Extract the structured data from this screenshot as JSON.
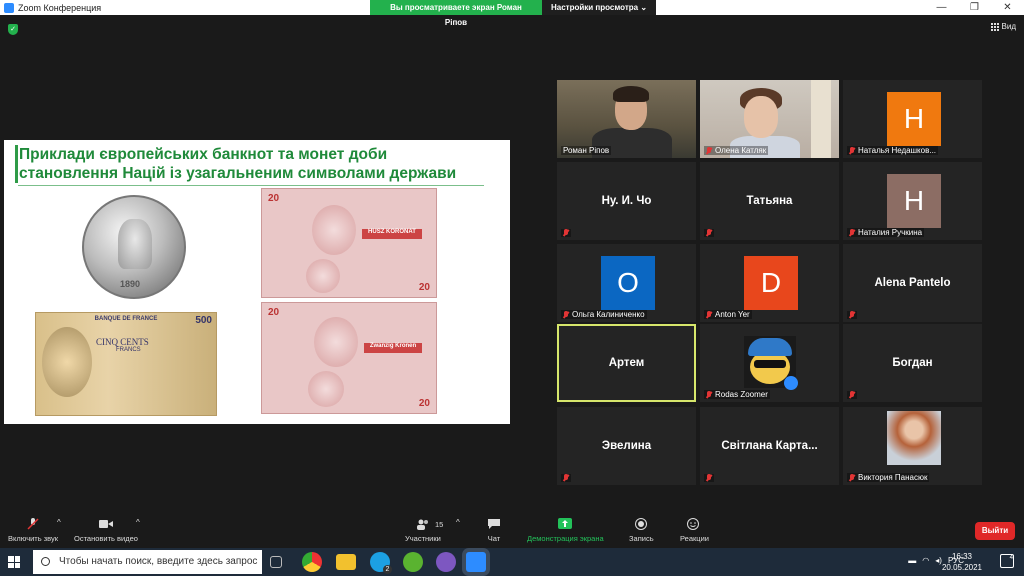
{
  "window": {
    "title": "Zoom Конференция"
  },
  "share": {
    "viewing": "Вы просматриваете экран Роман Ріпов",
    "view_options": "Настройки просмотра ⌄"
  },
  "view_button": "Вид",
  "slide": {
    "line1": "Приклади європейських банкнот та монет доби",
    "line2": "становлення Націй із узагальненим символами держави",
    "coin_year": "1890",
    "note_value": "20",
    "note_top_label": "HUSZ KORONAT",
    "note_bottom_label": "Zwanzig Kronen",
    "fr_header": "BANQUE DE FRANCE",
    "fr_value": "500",
    "fr_text": "CINQ CENTS",
    "fr_text2": "FRANCS"
  },
  "participants": [
    {
      "name": "Роман Ріпов",
      "label": "",
      "muted": false
    },
    {
      "name": "Олена Катляк",
      "label": "",
      "muted": true
    },
    {
      "name": "Наталья Недашков...",
      "label": "",
      "muted": true,
      "avatar": "Н",
      "avatar_color": "#f0790f"
    },
    {
      "name": "",
      "label": "Ну. И. Чо",
      "muted": true
    },
    {
      "name": "",
      "label": "Татьяна",
      "muted": true
    },
    {
      "name": "Наталия Ручкина",
      "label": "",
      "muted": true,
      "avatar": "Н",
      "avatar_color": "#8c6d64"
    },
    {
      "name": "Ольга Калиниченко",
      "label": "",
      "muted": true,
      "avatar": "О",
      "avatar_color": "#0b67c2"
    },
    {
      "name": "Anton Yer",
      "label": "",
      "muted": true,
      "avatar": "D",
      "avatar_color": "#e8471c"
    },
    {
      "name": "",
      "label": "Alena Pantelo",
      "muted": true
    },
    {
      "name": "",
      "label": "Артем",
      "muted": false,
      "active": true
    },
    {
      "name": "Rodas Zoomer",
      "label": "",
      "muted": true
    },
    {
      "name": "",
      "label": "Богдан",
      "muted": true
    },
    {
      "name": "",
      "label": "Эвелина",
      "muted": true
    },
    {
      "name": "",
      "label": "Світлана  Карта...",
      "muted": true
    },
    {
      "name": "Виктория Панасюк",
      "label": "",
      "muted": true
    }
  ],
  "toolbar": {
    "mute": "Включить звук",
    "video": "Остановить видео",
    "participants": "Участники",
    "participants_count": "15",
    "chat": "Чат",
    "share": "Демонстрация экрана",
    "record": "Запись",
    "reactions": "Реакции",
    "leave": "Выйти"
  },
  "taskbar": {
    "search_placeholder": "Чтобы начать поиск, введите здесь запрос",
    "skype_badge": "2",
    "lang": "РУС",
    "time": "16:33",
    "date": "20.05.2021",
    "notif_count": "4"
  }
}
